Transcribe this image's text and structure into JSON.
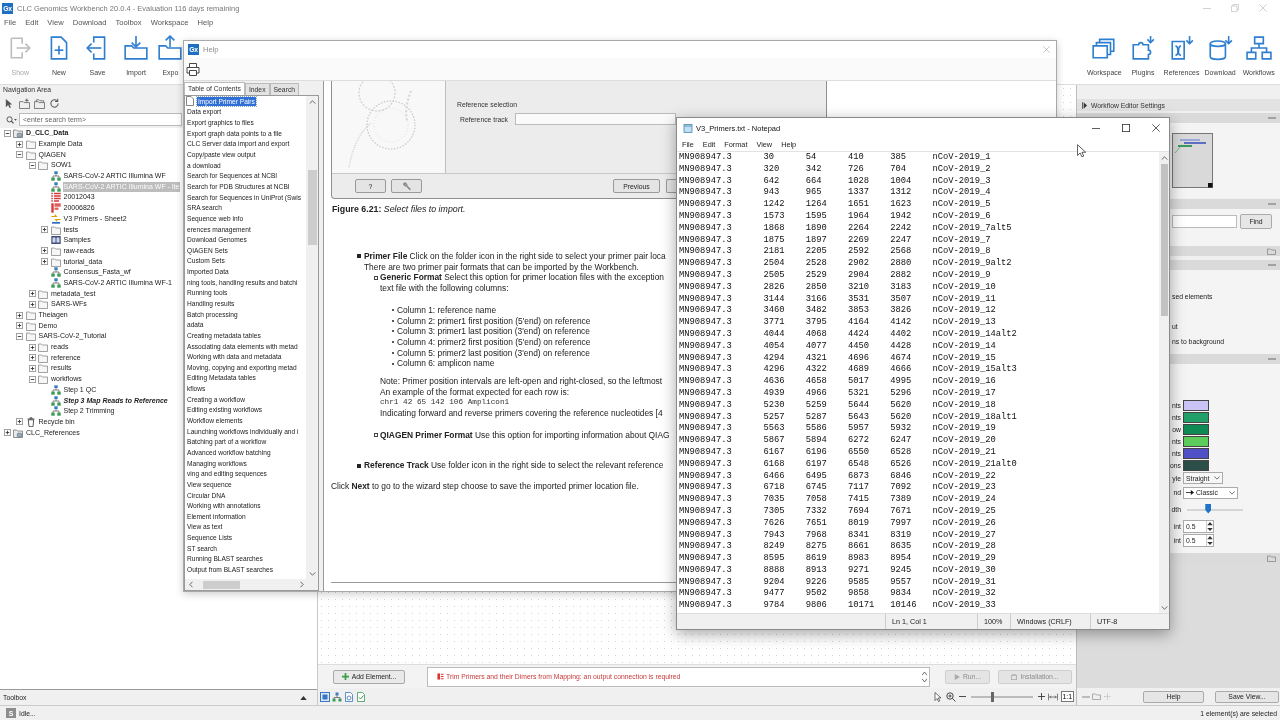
{
  "window": {
    "icon_label": "Gx",
    "title": "CLC Genomics Workbench 20.0.4 - Evaluation 116 days remaining"
  },
  "menu": [
    "File",
    "Edit",
    "View",
    "Download",
    "Toolbox",
    "Workspace",
    "Help"
  ],
  "toolbar_left": [
    {
      "label": "Show",
      "kind": "show",
      "disabled": true
    },
    {
      "label": "New",
      "kind": "new",
      "disabled": false
    },
    {
      "label": "Save",
      "kind": "save",
      "disabled": false
    },
    {
      "label": "Import",
      "kind": "import",
      "disabled": false
    },
    {
      "label": "Expo",
      "kind": "export",
      "disabled": false
    }
  ],
  "toolbar_right": [
    {
      "label": "Workspace",
      "kind": "workspace"
    },
    {
      "label": "Plugins",
      "kind": "plugins"
    },
    {
      "label": "References",
      "kind": "references"
    },
    {
      "label": "Download",
      "kind": "download"
    },
    {
      "label": "Workflows",
      "kind": "workflows"
    }
  ],
  "navigation": {
    "title": "Navigation Area",
    "search": {
      "placeholder": "<enter search term>"
    },
    "tree": [
      {
        "label": "D_CLC_Data",
        "kind": "home",
        "expanded": true,
        "selected": false,
        "children": [
          {
            "label": "Example Data",
            "kind": "folder",
            "expanded": false,
            "selected": false
          },
          {
            "label": "QIAGEN",
            "kind": "folder",
            "expanded": true,
            "selected": false,
            "children": [
              {
                "label": "SOW1",
                "kind": "folder",
                "expanded": true,
                "selected": false,
                "children": [
                  {
                    "label": "SARS-CoV-2 ARTIC Illumina WF",
                    "kind": "workflow",
                    "selected": false
                  },
                  {
                    "label": "SARS-CoV-2 ARTIC Illumina WF - ite",
                    "kind": "workflow",
                    "selected": true
                  },
                  {
                    "label": "20012043",
                    "kind": "table",
                    "selected": false
                  },
                  {
                    "label": "20006826",
                    "kind": "chart",
                    "selected": false
                  },
                  {
                    "label": "V3 Primers - Sheet2",
                    "kind": "primers",
                    "selected": false
                  },
                  {
                    "label": "tests",
                    "kind": "folder",
                    "expanded": false,
                    "selected": false
                  },
                  {
                    "label": "Samples",
                    "kind": "samples",
                    "selected": false
                  },
                  {
                    "label": "raw-reads",
                    "kind": "folder",
                    "expanded": false,
                    "selected": false
                  },
                  {
                    "label": "tutorial_data",
                    "kind": "folder",
                    "expanded": false,
                    "selected": false
                  },
                  {
                    "label": "Consensus_Fasta_wf",
                    "kind": "workflow",
                    "selected": false
                  },
                  {
                    "label": "SARS-CoV-2 ARTIC Illumina WF-1",
                    "kind": "workflow",
                    "selected": false
                  }
                ]
              },
              {
                "label": "metadata_test",
                "kind": "folder",
                "expanded": false,
                "selected": false
              },
              {
                "label": "SARS-WFs",
                "kind": "folder",
                "expanded": false,
                "selected": false
              }
            ]
          },
          {
            "label": "Theiagen",
            "kind": "folder",
            "expanded": false,
            "selected": false
          },
          {
            "label": "Demo",
            "kind": "folder",
            "expanded": false,
            "selected": false
          },
          {
            "label": "SARS-CoV-2_Tutorial",
            "kind": "folder",
            "expanded": true,
            "selected": false,
            "children": [
              {
                "label": "reads",
                "kind": "folder",
                "expanded": false,
                "selected": false
              },
              {
                "label": "reference",
                "kind": "folder",
                "expanded": false,
                "selected": false
              },
              {
                "label": "results",
                "kind": "folder",
                "expanded": false,
                "selected": false
              },
              {
                "label": "workflows",
                "kind": "folder",
                "expanded": true,
                "selected": false,
                "children": [
                  {
                    "label": "Step 1 QC",
                    "kind": "workflow",
                    "selected": false
                  },
                  {
                    "label": "Step 3 Map Reads to Reference",
                    "kind": "workflow_open",
                    "selected": false
                  },
                  {
                    "label": "Step 2 Trimming",
                    "kind": "workflow",
                    "selected": false
                  }
                ]
              }
            ]
          },
          {
            "label": "Recycle bin",
            "kind": "bin",
            "expanded": false,
            "selected": false
          }
        ]
      },
      {
        "label": "CLC_References",
        "kind": "location",
        "expanded": false,
        "selected": false
      }
    ]
  },
  "toolbox": {
    "title": "Toolbox"
  },
  "editor": {
    "add_button": "Add Element...",
    "message": "Trim Primers and their Dimers from Mapping: an output connection is required",
    "buttons": [
      {
        "label": "Run...",
        "kind": "run",
        "disabled": true
      },
      {
        "label": "Installation...",
        "kind": "install",
        "disabled": true
      }
    ],
    "zoom_slider": {
      "level": 0.35
    },
    "zoom_reset": "1:1"
  },
  "side_panel": {
    "title": "Workflow Editor Settings",
    "find_button": "Find",
    "texts": [
      "sed elements",
      "ut",
      "ns to background"
    ],
    "colors": [
      {
        "label": "nts",
        "color": "#c9c4f5"
      },
      {
        "label": "nts",
        "color": "#23a06a"
      },
      {
        "label": "ow",
        "color": "#0f8a55"
      },
      {
        "label": "nts",
        "color": "#5ccc5c"
      },
      {
        "label": "nts",
        "color": "#5250c6"
      },
      {
        "label": "ons",
        "color": "#2c4e49"
      }
    ],
    "rows": [
      {
        "kind": "dropdown",
        "label": "yle",
        "value": "Straight"
      },
      {
        "kind": "arrow_dropdown",
        "label": "nd",
        "value": "Classic"
      },
      {
        "kind": "slider",
        "label": "dth",
        "level": 0.38
      },
      {
        "kind": "spinner",
        "label": "int",
        "value": "0.5"
      },
      {
        "kind": "spinner",
        "label": "int",
        "value": "0.5"
      }
    ],
    "buttons": [
      "Help",
      "Save View..."
    ]
  },
  "help": {
    "icon_label": "Gx",
    "title": "Help",
    "tabs": [
      {
        "label": "Table of Contents",
        "selected": true
      },
      {
        "label": "Index",
        "selected": false
      },
      {
        "label": "Search",
        "selected": false
      }
    ],
    "toc": [
      {
        "label": "Import Primer Pairs",
        "kind": "page",
        "selected": true
      },
      {
        "label": "Data export",
        "kind": "topic",
        "selected": false
      },
      {
        "label": "Export graphics to files",
        "kind": "topic",
        "selected": false
      },
      {
        "label": "Export graph data points to a file",
        "kind": "topic",
        "selected": false
      },
      {
        "label": "CLC Server data import and export",
        "kind": "topic",
        "selected": false
      },
      {
        "label": "Copy/paste view output",
        "kind": "topic",
        "selected": false
      },
      {
        "label": "a download",
        "kind": "topic",
        "selected": false
      },
      {
        "label": "Search for Sequences at NCBI",
        "kind": "topic",
        "selected": false
      },
      {
        "label": "Search for PDB Structures at NCBI",
        "kind": "topic",
        "selected": false
      },
      {
        "label": "Search for Sequences in UniProt (Swis",
        "kind": "topic",
        "selected": false
      },
      {
        "label": "SRA search",
        "kind": "topic",
        "selected": false
      },
      {
        "label": "Sequence web info",
        "kind": "topic",
        "selected": false
      },
      {
        "label": "erences management",
        "kind": "topic",
        "selected": false
      },
      {
        "label": "Download Genomes",
        "kind": "topic",
        "selected": false
      },
      {
        "label": "QIAGEN Sets",
        "kind": "topic",
        "selected": false
      },
      {
        "label": "Custom Sets",
        "kind": "topic",
        "selected": false
      },
      {
        "label": "Imported Data",
        "kind": "topic",
        "selected": false
      },
      {
        "label": "ning tools, handling results and batchi",
        "kind": "topic",
        "selected": false
      },
      {
        "label": "Running tools",
        "kind": "topic",
        "selected": false
      },
      {
        "label": "Handling results",
        "kind": "topic",
        "selected": false
      },
      {
        "label": "Batch processing",
        "kind": "topic",
        "selected": false
      },
      {
        "label": "adata",
        "kind": "topic",
        "selected": false
      },
      {
        "label": "Creating metadata tables",
        "kind": "topic",
        "selected": false
      },
      {
        "label": "Associating data elements with metad",
        "kind": "topic",
        "selected": false
      },
      {
        "label": "Working with data and metadata",
        "kind": "topic",
        "selected": false
      },
      {
        "label": "Moving, copying and exporting metad",
        "kind": "topic",
        "selected": false
      },
      {
        "label": "Editing Metadata tables",
        "kind": "topic",
        "selected": false
      },
      {
        "label": "kflows",
        "kind": "topic",
        "selected": false
      },
      {
        "label": "Creating a workflow",
        "kind": "topic",
        "selected": false
      },
      {
        "label": "Editing existing workflows",
        "kind": "topic",
        "selected": false
      },
      {
        "label": "Workflow elements",
        "kind": "topic",
        "selected": false
      },
      {
        "label": "Launching workflows individually and i",
        "kind": "topic",
        "selected": false
      },
      {
        "label": "Batching part of a workflow",
        "kind": "topic",
        "selected": false
      },
      {
        "label": "Advanced workflow batching",
        "kind": "topic",
        "selected": false
      },
      {
        "label": "Managing workflows",
        "kind": "topic",
        "selected": false
      },
      {
        "label": "ving and editing sequences",
        "kind": "topic",
        "selected": false
      },
      {
        "label": "View sequence",
        "kind": "topic",
        "selected": false
      },
      {
        "label": "Circular DNA",
        "kind": "topic",
        "selected": false
      },
      {
        "label": "Working with annotations",
        "kind": "topic",
        "selected": false
      },
      {
        "label": "Element information",
        "kind": "topic",
        "selected": false
      },
      {
        "label": "View as text",
        "kind": "topic",
        "selected": false
      },
      {
        "label": "Sequence Lists",
        "kind": "topic",
        "selected": false
      },
      {
        "label": "ST search",
        "kind": "topic",
        "selected": false
      },
      {
        "label": "Running BLAST searches",
        "kind": "topic",
        "selected": false
      },
      {
        "label": "Output from BLAST searches",
        "kind": "topic",
        "selected": false
      }
    ],
    "figure": {
      "group_label": "Reference selection",
      "field_label": "Reference track",
      "buttons": [
        {
          "kind": "help",
          "label": "?"
        },
        {
          "kind": "tool"
        },
        {
          "kind": "previous",
          "label": "Previous"
        },
        {
          "kind": "partial"
        }
      ],
      "caption": "**Figure 6.21:** *Select files to import.*"
    },
    "content": [
      {
        "kind": "square",
        "text": "**Primer File** Click on the folder icon in the right side to select your primer pair loca",
        "children": [
          {
            "kind": "line",
            "text": "There are two primer pair formats that can be imported by the Workbench."
          },
          {
            "kind": "hollow",
            "text": "**Generic Format** Select this option for primer location files with the exception",
            "children": [
              {
                "kind": "line",
                "text": "text file with the following columns:"
              },
              {
                "kind": "list",
                "children": [
                  {
                    "kind": "dot",
                    "text": "Column 1: reference name"
                  },
                  {
                    "kind": "dot",
                    "text": "Column 2: primer1 first position (5'end) on reference"
                  },
                  {
                    "kind": "dot",
                    "text": "Column 3: primer1 last position (3'end) on reference"
                  },
                  {
                    "kind": "dot",
                    "text": "Column 4: primer2 first position (5'end) on reference"
                  },
                  {
                    "kind": "dot",
                    "text": "Column 5: primer2 last position (3'end) on reference"
                  },
                  {
                    "kind": "dot",
                    "text": "Column 6: amplicon name"
                  }
                ]
              },
              {
                "kind": "block",
                "children": [
                  {
                    "kind": "line",
                    "text": "Note: Primer position intervals are left-open and right-closed, so the leftmost"
                  },
                  {
                    "kind": "line",
                    "text": "An example of the format expected for each row is:"
                  },
                  {
                    "kind": "code",
                    "text": "chr1 42 65 142 106 Amplicon1"
                  },
                  {
                    "kind": "line",
                    "text": "Indicating forward and reverse primers covering the reference nucleotides [4"
                  }
                ]
              }
            ]
          },
          {
            "kind": "hollow",
            "text": "**QIAGEN Primer Format** Use this option for importing information about QIAG"
          }
        ]
      },
      {
        "kind": "square",
        "text": "**Reference Track** Use folder icon in the right side to select the relevant reference"
      },
      {
        "kind": "line",
        "text": "Click **Next** to go to the wizard step choose to save the imported primer location file."
      }
    ]
  },
  "notepad": {
    "title": "V3_Primers.txt - Notepad",
    "menu": [
      "File",
      "Edit",
      "Format",
      "View",
      "Help"
    ],
    "lines": [
      "MN908947.3\t30\t54\t410\t385\tnCoV-2019_1",
      "MN908947.3\t320\t342\t726\t704\tnCoV-2019_2",
      "MN908947.3\t642\t664\t1028\t1004\tnCoV-2019_3",
      "MN908947.3\t943\t965\t1337\t1312\tnCoV-2019_4",
      "MN908947.3\t1242\t1264\t1651\t1623\tnCoV-2019_5",
      "MN908947.3\t1573\t1595\t1964\t1942\tnCoV-2019_6",
      "MN908947.3\t1868\t1890\t2264\t2242\tnCoV-2019_7alt5",
      "MN908947.3\t1875\t1897\t2269\t2247\tnCoV-2019_7",
      "MN908947.3\t2181\t2205\t2592\t2568\tnCoV-2019_8",
      "MN908947.3\t2504\t2528\t2902\t2880\tnCoV-2019_9alt2",
      "MN908947.3\t2505\t2529\t2904\t2882\tnCoV-2019_9",
      "MN908947.3\t2826\t2850\t3210\t3183\tnCoV-2019_10",
      "MN908947.3\t3144\t3166\t3531\t3507\tnCoV-2019_11",
      "MN908947.3\t3460\t3482\t3853\t3826\tnCoV-2019_12",
      "MN908947.3\t3771\t3795\t4164\t4142\tnCoV-2019_13",
      "MN908947.3\t4044\t4068\t4424\t4402\tnCoV-2019_14alt2",
      "MN908947.3\t4054\t4077\t4450\t4428\tnCoV-2019_14",
      "MN908947.3\t4294\t4321\t4696\t4674\tnCoV-2019_15",
      "MN908947.3\t4296\t4322\t4689\t4666\tnCoV-2019_15alt3",
      "MN908947.3\t4636\t4658\t5017\t4995\tnCoV-2019_16",
      "MN908947.3\t4939\t4966\t5321\t5296\tnCoV-2019_17",
      "MN908947.3\t5230\t5259\t5644\t5620\tnCoV-2019_18",
      "MN908947.3\t5257\t5287\t5643\t5620\tnCoV-2019_18alt1",
      "MN908947.3\t5563\t5586\t5957\t5932\tnCoV-2019_19",
      "MN908947.3\t5867\t5894\t6272\t6247\tnCoV-2019_20",
      "MN908947.3\t6167\t6196\t6550\t6528\tnCoV-2019_21",
      "MN908947.3\t6168\t6197\t6548\t6526\tnCoV-2019_21alt0",
      "MN908947.3\t6466\t6495\t6873\t6846\tnCoV-2019_22",
      "MN908947.3\t6718\t6745\t7117\t7092\tnCoV-2019_23",
      "MN908947.3\t7035\t7058\t7415\t7389\tnCoV-2019_24",
      "MN908947.3\t7305\t7332\t7694\t7671\tnCoV-2019_25",
      "MN908947.3\t7626\t7651\t8019\t7997\tnCoV-2019_26",
      "MN908947.3\t7943\t7968\t8341\t8319\tnCoV-2019_27",
      "MN908947.3\t8249\t8275\t8661\t8635\tnCoV-2019_28",
      "MN908947.3\t8595\t8619\t8983\t8954\tnCoV-2019_29",
      "MN908947.3\t8888\t8913\t9271\t9245\tnCoV-2019_30",
      "MN908947.3\t9204\t9226\t9585\t9557\tnCoV-2019_31",
      "MN908947.3\t9477\t9502\t9858\t9834\tnCoV-2019_32",
      "MN908947.3\t9784\t9806\t10171\t10146\tnCoV-2019_33"
    ],
    "status": [
      "Ln 1, Col 1",
      "100%",
      "Windows (CRLF)",
      "UTF-8"
    ]
  },
  "status_bar": {
    "icon_label": "S",
    "left": "Idle...",
    "right": "1 element(s) are selected"
  }
}
